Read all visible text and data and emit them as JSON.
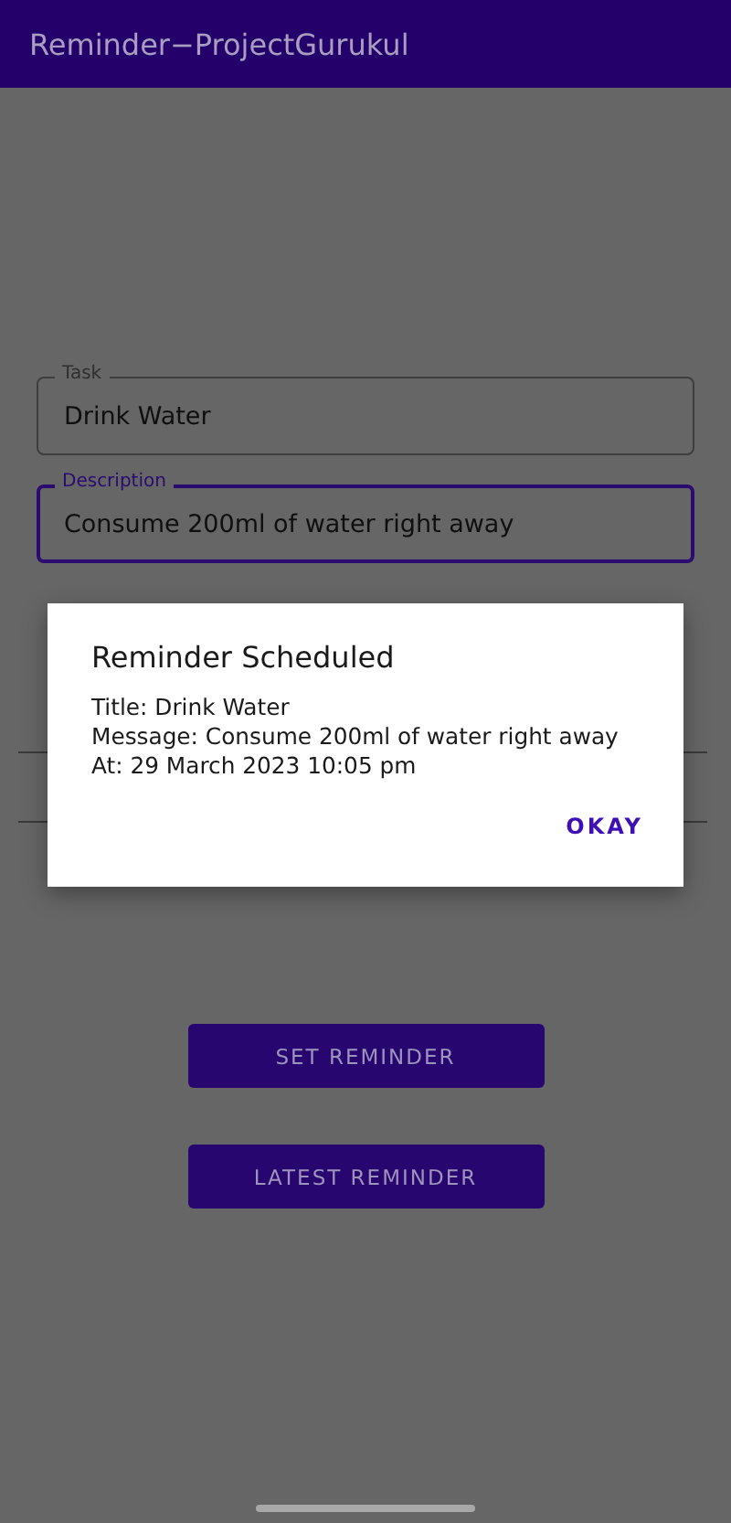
{
  "app_bar": {
    "title": "Reminder−ProjectGurukul"
  },
  "fields": [
    {
      "label": "Task",
      "value": "Drink Water",
      "focused": false
    },
    {
      "label": "Description",
      "value": "Consume 200ml of water right away",
      "focused": true
    }
  ],
  "buttons": [
    "SET REMINDER",
    "LATEST REMINDER"
  ],
  "dialog": {
    "title": "Reminder Scheduled",
    "lines": [
      "Title: Drink Water",
      "Message: Consume 200ml of water right away",
      "At: 29 March 2023 10:05 pm"
    ],
    "button": "OKAY"
  }
}
